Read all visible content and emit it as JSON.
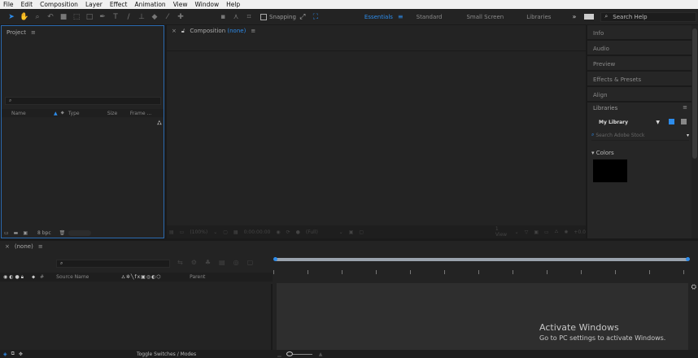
{
  "menu": [
    "File",
    "Edit",
    "Composition",
    "Layer",
    "Effect",
    "Animation",
    "View",
    "Window",
    "Help"
  ],
  "toolbar": {
    "snapping_label": "Snapping",
    "workspaces": [
      "Essentials",
      "Standard",
      "Small Screen",
      "Libraries"
    ],
    "active_workspace": "Essentials",
    "more": "»",
    "search_placeholder": "Search Help"
  },
  "project": {
    "title": "Project",
    "columns": [
      "Name",
      "Type",
      "Size",
      "Frame ..."
    ],
    "bpc": "8 bpc"
  },
  "composition": {
    "title": "Composition",
    "name": "(none)",
    "zoom": "(100%)",
    "timecode": "0:00:00:00",
    "resolution": "(Full)",
    "views": "1 View",
    "exposure": "+0.0"
  },
  "right_panels": [
    "Info",
    "Audio",
    "Preview",
    "Effects & Presets",
    "Align"
  ],
  "libraries": {
    "title": "Libraries",
    "library": "My Library",
    "search_placeholder": "Search Adobe Stock",
    "section": "Colors",
    "swatch_color": "#000000"
  },
  "timeline": {
    "title": "(none)",
    "columns": [
      "#",
      "Source Name",
      "Parent"
    ],
    "toggle_label": "Toggle Switches / Modes"
  },
  "watermark": {
    "title": "Activate Windows",
    "subtitle": "Go to PC settings to activate Windows."
  },
  "colors": {
    "accent": "#2d8ceb",
    "panel": "#232323",
    "menubar": "#f0f0f0"
  }
}
